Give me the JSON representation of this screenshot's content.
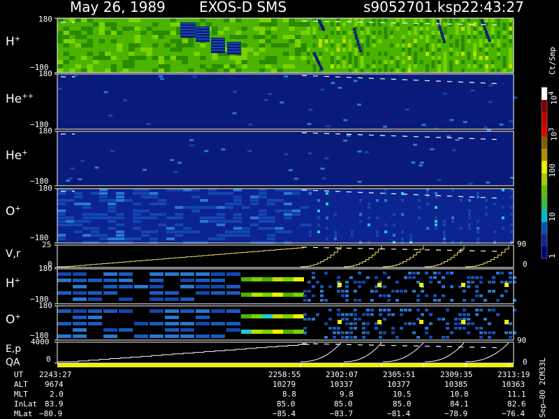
{
  "header": {
    "date": "May 26, 1989",
    "instrument": "EXOS-D SMS",
    "file": "s9052701.ksp",
    "time": "22:43:27"
  },
  "colorbar": {
    "unit": "Ct/Smp",
    "tick_labels": [
      "1",
      "10",
      "100",
      "10",
      "10"
    ],
    "tick_exps": [
      "",
      "",
      "",
      "3",
      "4"
    ],
    "tick_values": [
      1,
      10,
      100,
      1000,
      10000
    ],
    "colors": [
      "#000080",
      "#0a2a8a",
      "#0050c0",
      "#00b8d0",
      "#30c040",
      "#60c000",
      "#a0d000",
      "#f0f000",
      "#b09000",
      "#806000",
      "#e00000",
      "#c00000",
      "#800000",
      "#ffffff"
    ]
  },
  "colors": {
    "dark_blue": "#0a1a7a",
    "mid_blue": "#1446b0",
    "light_blue": "#2878d0",
    "cyan": "#18d0d0",
    "green_dark": "#2a8a00",
    "green": "#4ab400",
    "green_light": "#7ad200",
    "yellow_green": "#b8e000",
    "yellow": "#f0f000",
    "trace": "#f0e070"
  },
  "panels": [
    {
      "label": "H",
      "sup": "+",
      "ymax": "180",
      "ymin": "−180",
      "ylim": [
        -180,
        180
      ]
    },
    {
      "label": "He",
      "sup": "++",
      "ymax": "180",
      "ymin": "−180",
      "ylim": [
        -180,
        180
      ]
    },
    {
      "label": "He",
      "sup": "+",
      "ymax": "180",
      "ymin": "−180",
      "ylim": [
        -180,
        180
      ]
    },
    {
      "label": "O",
      "sup": "+",
      "ymax": "180",
      "ymin": "−180",
      "ylim": [
        -180,
        180
      ]
    },
    {
      "label": "V,r",
      "sup": "",
      "ymax": "25",
      "ymin": "0",
      "right_max": "90",
      "right_min": "0",
      "ylim": [
        0,
        25
      ]
    },
    {
      "label": "H",
      "sup": "+",
      "ymax": "180",
      "ymin": "−180",
      "ylim": [
        -180,
        180
      ]
    },
    {
      "label": "O",
      "sup": "+",
      "ymax": "180",
      "ymin": "−180",
      "ylim": [
        -180,
        180
      ]
    },
    {
      "label": "E,p",
      "sup": "",
      "ymax": "4000",
      "ymin": "0",
      "right_max": "90",
      "right_min": "0",
      "ylim": [
        0,
        4000
      ]
    }
  ],
  "qa_label": "QA",
  "footer": {
    "row_labels": [
      "UT",
      "ALT",
      "MLT",
      "InLat",
      "MLat"
    ],
    "columns": [
      {
        "values": [
          "2243:27",
          "9674",
          "2.0",
          "83.9",
          "−80.9"
        ]
      },
      {
        "values": [
          "2258:55",
          "10279",
          "8.8",
          "85.0",
          "−85.4"
        ]
      },
      {
        "values": [
          "2302:07",
          "10337",
          "9.8",
          "85.0",
          "−83.7"
        ]
      },
      {
        "values": [
          "2305:51",
          "10377",
          "10.5",
          "85.0",
          "−81.4"
        ]
      },
      {
        "values": [
          "2309:35",
          "10385",
          "10.8",
          "84.1",
          "−78.9"
        ]
      },
      {
        "values": [
          "2313:19",
          "10363",
          "11.1",
          "82.6",
          "−76.4"
        ]
      }
    ]
  },
  "side_note": "Sep–00 2CM33L",
  "chart_data": {
    "type": "heatmap",
    "x_label": "UT",
    "x_ticks": [
      "2243:27",
      "2258:55",
      "2302:07",
      "2305:51",
      "2309:35",
      "2313:19"
    ],
    "panels": [
      {
        "name": "H+",
        "ylim": [
          -180,
          180
        ],
        "background": "green"
      },
      {
        "name": "He++",
        "ylim": [
          -180,
          180
        ],
        "background": "dark_blue"
      },
      {
        "name": "He+",
        "ylim": [
          -180,
          180
        ],
        "background": "dark_blue"
      },
      {
        "name": "O+",
        "ylim": [
          -180,
          180
        ],
        "background": "mid_blue"
      },
      {
        "name": "V,r",
        "ylim": [
          0,
          25
        ],
        "right_ylim": [
          0,
          90
        ],
        "background": "black"
      },
      {
        "name": "H+",
        "ylim": [
          -180,
          180
        ],
        "background": "black"
      },
      {
        "name": "O+",
        "ylim": [
          -180,
          180
        ],
        "background": "black"
      },
      {
        "name": "E,p",
        "ylim": [
          0,
          4000
        ],
        "right_ylim": [
          0,
          90
        ],
        "background": "black"
      }
    ],
    "colorscale": "log",
    "colorbar_range": [
      1,
      10000
    ]
  }
}
